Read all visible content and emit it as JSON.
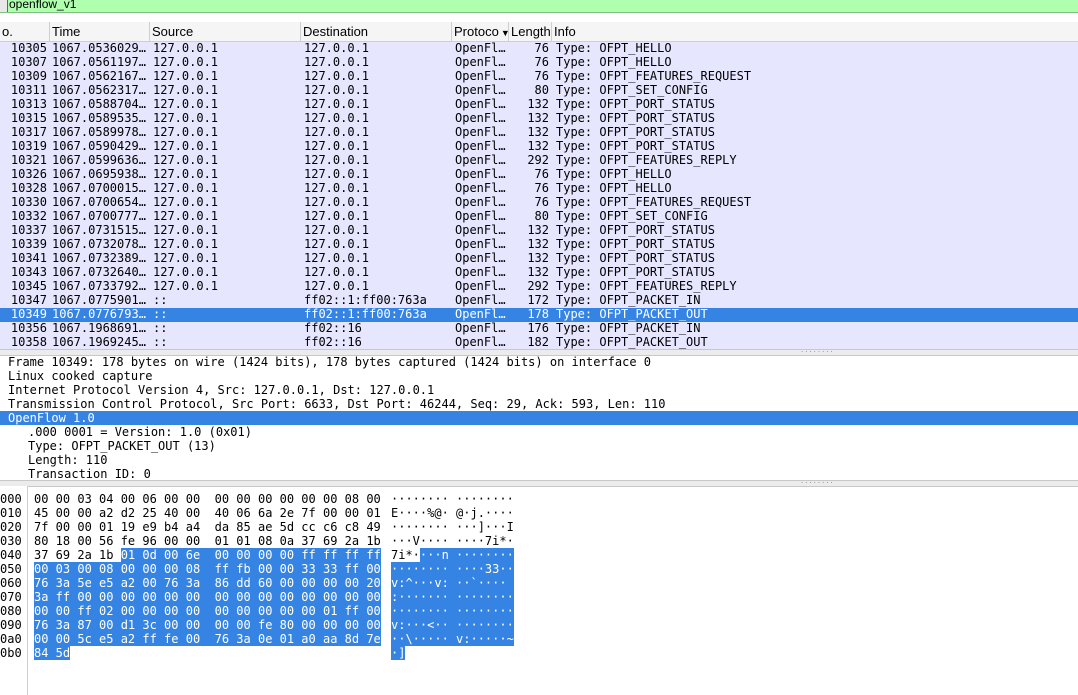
{
  "filter": {
    "value": "openflow_v1"
  },
  "columns": {
    "no": "o.",
    "time": "Time",
    "source": "Source",
    "destination": "Destination",
    "protocol": "Protoco",
    "length": "Length",
    "info": "Info"
  },
  "packets": [
    {
      "no": "10305",
      "time": "1067.0536029…",
      "src": "127.0.0.1",
      "dst": "127.0.0.1",
      "proto": "OpenFl…",
      "len": "76",
      "info": "Type: OFPT_HELLO"
    },
    {
      "no": "10307",
      "time": "1067.0561197…",
      "src": "127.0.0.1",
      "dst": "127.0.0.1",
      "proto": "OpenFl…",
      "len": "76",
      "info": "Type: OFPT_HELLO"
    },
    {
      "no": "10309",
      "time": "1067.0562167…",
      "src": "127.0.0.1",
      "dst": "127.0.0.1",
      "proto": "OpenFl…",
      "len": "76",
      "info": "Type: OFPT_FEATURES_REQUEST"
    },
    {
      "no": "10311",
      "time": "1067.0562317…",
      "src": "127.0.0.1",
      "dst": "127.0.0.1",
      "proto": "OpenFl…",
      "len": "80",
      "info": "Type: OFPT_SET_CONFIG"
    },
    {
      "no": "10313",
      "time": "1067.0588704…",
      "src": "127.0.0.1",
      "dst": "127.0.0.1",
      "proto": "OpenFl…",
      "len": "132",
      "info": "Type: OFPT_PORT_STATUS"
    },
    {
      "no": "10315",
      "time": "1067.0589535…",
      "src": "127.0.0.1",
      "dst": "127.0.0.1",
      "proto": "OpenFl…",
      "len": "132",
      "info": "Type: OFPT_PORT_STATUS"
    },
    {
      "no": "10317",
      "time": "1067.0589978…",
      "src": "127.0.0.1",
      "dst": "127.0.0.1",
      "proto": "OpenFl…",
      "len": "132",
      "info": "Type: OFPT_PORT_STATUS"
    },
    {
      "no": "10319",
      "time": "1067.0590429…",
      "src": "127.0.0.1",
      "dst": "127.0.0.1",
      "proto": "OpenFl…",
      "len": "132",
      "info": "Type: OFPT_PORT_STATUS"
    },
    {
      "no": "10321",
      "time": "1067.0599636…",
      "src": "127.0.0.1",
      "dst": "127.0.0.1",
      "proto": "OpenFl…",
      "len": "292",
      "info": "Type: OFPT_FEATURES_REPLY"
    },
    {
      "no": "10326",
      "time": "1067.0695938…",
      "src": "127.0.0.1",
      "dst": "127.0.0.1",
      "proto": "OpenFl…",
      "len": "76",
      "info": "Type: OFPT_HELLO"
    },
    {
      "no": "10328",
      "time": "1067.0700015…",
      "src": "127.0.0.1",
      "dst": "127.0.0.1",
      "proto": "OpenFl…",
      "len": "76",
      "info": "Type: OFPT_HELLO"
    },
    {
      "no": "10330",
      "time": "1067.0700654…",
      "src": "127.0.0.1",
      "dst": "127.0.0.1",
      "proto": "OpenFl…",
      "len": "76",
      "info": "Type: OFPT_FEATURES_REQUEST"
    },
    {
      "no": "10332",
      "time": "1067.0700777…",
      "src": "127.0.0.1",
      "dst": "127.0.0.1",
      "proto": "OpenFl…",
      "len": "80",
      "info": "Type: OFPT_SET_CONFIG"
    },
    {
      "no": "10337",
      "time": "1067.0731515…",
      "src": "127.0.0.1",
      "dst": "127.0.0.1",
      "proto": "OpenFl…",
      "len": "132",
      "info": "Type: OFPT_PORT_STATUS"
    },
    {
      "no": "10339",
      "time": "1067.0732078…",
      "src": "127.0.0.1",
      "dst": "127.0.0.1",
      "proto": "OpenFl…",
      "len": "132",
      "info": "Type: OFPT_PORT_STATUS"
    },
    {
      "no": "10341",
      "time": "1067.0732389…",
      "src": "127.0.0.1",
      "dst": "127.0.0.1",
      "proto": "OpenFl…",
      "len": "132",
      "info": "Type: OFPT_PORT_STATUS"
    },
    {
      "no": "10343",
      "time": "1067.0732640…",
      "src": "127.0.0.1",
      "dst": "127.0.0.1",
      "proto": "OpenFl…",
      "len": "132",
      "info": "Type: OFPT_PORT_STATUS"
    },
    {
      "no": "10345",
      "time": "1067.0733792…",
      "src": "127.0.0.1",
      "dst": "127.0.0.1",
      "proto": "OpenFl…",
      "len": "292",
      "info": "Type: OFPT_FEATURES_REPLY"
    },
    {
      "no": "10347",
      "time": "1067.0775901…",
      "src": "::",
      "dst": "ff02::1:ff00:763a",
      "proto": "OpenFl…",
      "len": "172",
      "info": "Type: OFPT_PACKET_IN"
    },
    {
      "no": "10349",
      "time": "1067.0776793…",
      "src": "::",
      "dst": "ff02::1:ff00:763a",
      "proto": "OpenFl…",
      "len": "178",
      "info": "Type: OFPT_PACKET_OUT",
      "selected": true
    },
    {
      "no": "10356",
      "time": "1067.1968691…",
      "src": "::",
      "dst": "ff02::16",
      "proto": "OpenFl…",
      "len": "176",
      "info": "Type: OFPT_PACKET_IN"
    },
    {
      "no": "10358",
      "time": "1067.1969245…",
      "src": "::",
      "dst": "ff02::16",
      "proto": "OpenFl…",
      "len": "182",
      "info": "Type: OFPT_PACKET_OUT"
    }
  ],
  "details": [
    {
      "text": "Frame 10349: 178 bytes on wire (1424 bits), 178 bytes captured (1424 bits) on interface 0",
      "level": 0
    },
    {
      "text": "Linux cooked capture",
      "level": 0
    },
    {
      "text": "Internet Protocol Version 4, Src: 127.0.0.1, Dst: 127.0.0.1",
      "level": 0
    },
    {
      "text": "Transmission Control Protocol, Src Port: 6633, Dst Port: 46244, Seq: 29, Ack: 593, Len: 110",
      "level": 0
    },
    {
      "text": "OpenFlow 1.0",
      "level": 0,
      "selected": true
    },
    {
      "text": ".000 0001 = Version: 1.0 (0x01)",
      "level": 1
    },
    {
      "text": "Type: OFPT_PACKET_OUT (13)",
      "level": 1
    },
    {
      "text": "Length: 110",
      "level": 1
    },
    {
      "text": "Transaction ID: 0",
      "level": 1
    }
  ],
  "bytes": [
    {
      "off": "000",
      "hex": [
        "00",
        "00",
        "03",
        "04",
        "00",
        "06",
        "00",
        "00",
        "00",
        "00",
        "00",
        "00",
        "00",
        "00",
        "08",
        "00"
      ],
      "ascii": "········ ········"
    },
    {
      "off": "010",
      "hex": [
        "45",
        "00",
        "00",
        "a2",
        "d2",
        "25",
        "40",
        "00",
        "40",
        "06",
        "6a",
        "2e",
        "7f",
        "00",
        "00",
        "01"
      ],
      "ascii": "E····%@· @·j.····"
    },
    {
      "off": "020",
      "hex": [
        "7f",
        "00",
        "00",
        "01",
        "19",
        "e9",
        "b4",
        "a4",
        "da",
        "85",
        "ae",
        "5d",
        "cc",
        "c6",
        "c8",
        "49"
      ],
      "ascii": "········ ···]···I"
    },
    {
      "off": "030",
      "hex": [
        "80",
        "18",
        "00",
        "56",
        "fe",
        "96",
        "00",
        "00",
        "01",
        "01",
        "08",
        "0a",
        "37",
        "69",
        "2a",
        "1b"
      ],
      "ascii": "···V···· ····7i*·"
    },
    {
      "off": "040",
      "hex": [
        "37",
        "69",
        "2a",
        "1b",
        "01",
        "0d",
        "00",
        "6e",
        "00",
        "00",
        "00",
        "00",
        "ff",
        "ff",
        "ff",
        "ff"
      ],
      "ascii": "7i*····n ········",
      "hlstart": 4
    },
    {
      "off": "050",
      "hex": [
        "00",
        "03",
        "00",
        "08",
        "00",
        "00",
        "00",
        "08",
        "ff",
        "fb",
        "00",
        "00",
        "33",
        "33",
        "ff",
        "00"
      ],
      "ascii": "········ ····33··",
      "hlstart": 0
    },
    {
      "off": "060",
      "hex": [
        "76",
        "3a",
        "5e",
        "e5",
        "a2",
        "00",
        "76",
        "3a",
        "86",
        "dd",
        "60",
        "00",
        "00",
        "00",
        "00",
        "20"
      ],
      "ascii": "v:^···v: ··`···· ",
      "hlstart": 0
    },
    {
      "off": "070",
      "hex": [
        "3a",
        "ff",
        "00",
        "00",
        "00",
        "00",
        "00",
        "00",
        "00",
        "00",
        "00",
        "00",
        "00",
        "00",
        "00",
        "00"
      ],
      "ascii": ":······· ········",
      "hlstart": 0
    },
    {
      "off": "080",
      "hex": [
        "00",
        "00",
        "ff",
        "02",
        "00",
        "00",
        "00",
        "00",
        "00",
        "00",
        "00",
        "00",
        "00",
        "01",
        "ff",
        "00"
      ],
      "ascii": "········ ········",
      "hlstart": 0
    },
    {
      "off": "090",
      "hex": [
        "76",
        "3a",
        "87",
        "00",
        "d1",
        "3c",
        "00",
        "00",
        "00",
        "00",
        "fe",
        "80",
        "00",
        "00",
        "00",
        "00"
      ],
      "ascii": "v:···<·· ········",
      "hlstart": 0
    },
    {
      "off": "0a0",
      "hex": [
        "00",
        "00",
        "5c",
        "e5",
        "a2",
        "ff",
        "fe",
        "00",
        "76",
        "3a",
        "0e",
        "01",
        "a0",
        "aa",
        "8d",
        "7e"
      ],
      "ascii": "··\\····· v:·····~",
      "hlstart": 0
    },
    {
      "off": "0b0",
      "hex": [
        "84",
        "5d"
      ],
      "ascii": "·]",
      "hlstart": 0
    }
  ]
}
